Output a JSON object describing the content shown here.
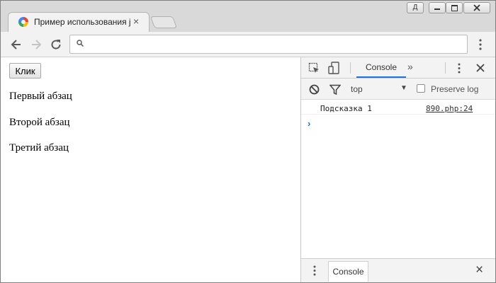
{
  "browser": {
    "tab_title": "Пример использования jQuery",
    "tab_close_icon": "×",
    "window_controls": {
      "user_badge": "Д"
    },
    "omnibox": {
      "value": "",
      "placeholder": ""
    }
  },
  "page": {
    "button_label": "Клик",
    "paragraphs": [
      "Первый абзац",
      "Второй абзац",
      "Третий абзац"
    ]
  },
  "devtools": {
    "active_tab": "Console",
    "more_tabs_icon": "»",
    "context": "top",
    "context_caret": "▼",
    "preserve_log_label": "Preserve log",
    "preserve_log_checked": false,
    "messages": [
      {
        "text": "Подсказка 1",
        "source": "890.php:24"
      }
    ],
    "prompt_symbol": "›",
    "drawer": {
      "tab_label": "Console",
      "close_icon": "×"
    }
  },
  "colors": {
    "accent": "#1a73e8",
    "titlebar": "#d9d9d9",
    "toolbar": "#f2f2f2",
    "devtools_bar": "#f3f3f3"
  }
}
